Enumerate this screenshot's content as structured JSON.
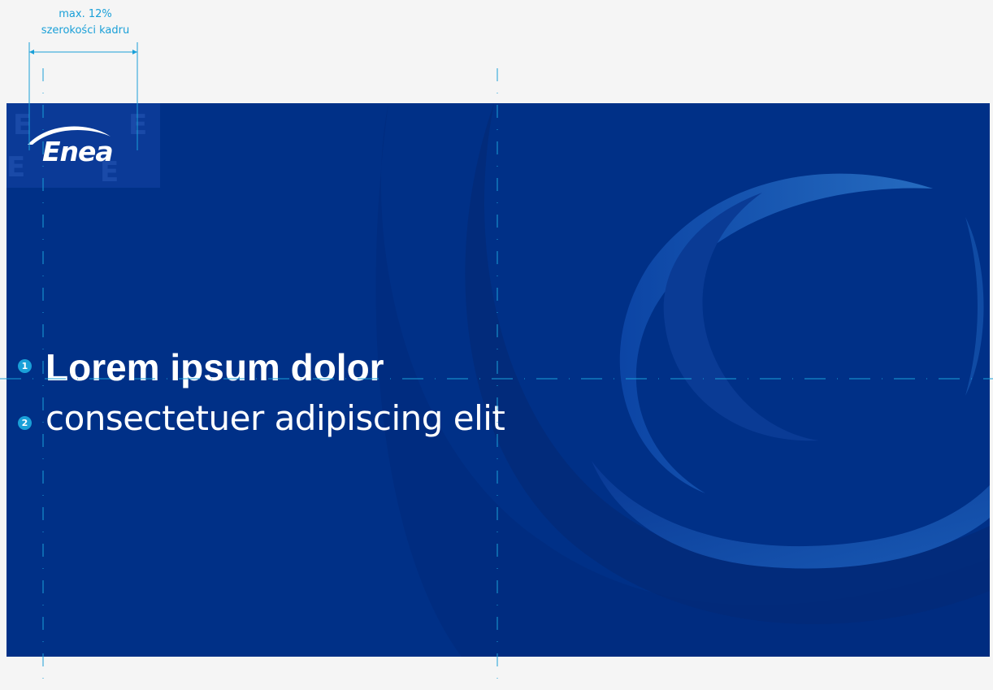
{
  "annotation": {
    "line1": "max. 12%",
    "line2": "szerokości kadru"
  },
  "logo": {
    "text": "Enea"
  },
  "headline": {
    "badge": "1",
    "text": "Lorem ipsum dolor"
  },
  "subline": {
    "badge": "2",
    "text": "consectetuer adipiscing elit"
  },
  "colors": {
    "page_background": "#f5f5f5",
    "brand_blue": "#003087",
    "guide_cyan": "#1aa0d8",
    "text": "#ffffff"
  }
}
